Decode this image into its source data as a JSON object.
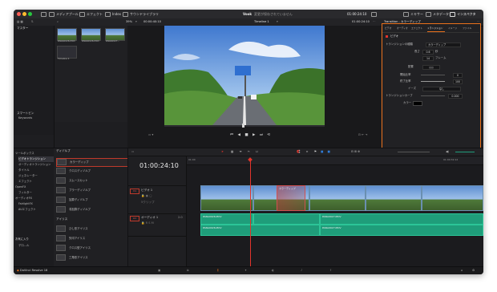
{
  "topbar": {
    "media_pool": "メディアプール",
    "effects": "エフェクト",
    "index": "Index",
    "sound_library": "サウンドライブラリ",
    "project_name": "Vook",
    "save_status": "変更が保存されていません",
    "timecode": "01:00:24:10",
    "mixer": "ミキサー",
    "metadata": "メタデータ",
    "inspector": "インスペクタ"
  },
  "bar2": {
    "zoom": "39%",
    "source_tc": "00:00:40:10",
    "timeline_name": "Timeline 1",
    "inspector_title": "Transition - カラーディップ"
  },
  "media_pool": {
    "bin": "マスター",
    "clips": [
      "PANA0026.MOV",
      "PANA0026.MOV",
      "PANA0027...",
      "Timeline 1"
    ],
    "smart_bins": "スマートビン",
    "keywords": "Keywords"
  },
  "effects_tree": [
    "ツールボックス",
    "ビデオトランジション",
    "オーディオトランジション",
    "タイトル",
    "ジェネレーター",
    "エフェクト",
    "OpenFX",
    "フィルター",
    "オーディオFX",
    "FairlightFX",
    "AUエフェクト"
  ],
  "favorites": {
    "title": "お気に入り",
    "item": "デロ...ル"
  },
  "dissolve": {
    "title": "ディゾルブ",
    "items": [
      "カラーディップ",
      "クロスディゾルブ",
      "スムースカット",
      "ブラーディゾルブ",
      "加算ディゾルブ",
      "非加算ディゾルブ"
    ]
  },
  "iris": {
    "title": "アイリス",
    "items": [
      "ひし形アイリス",
      "矢印アイリス",
      "クロス型アイリス",
      "三角形アイリス"
    ]
  },
  "inspector": {
    "tabs": [
      "ビデオ",
      "オーディオ",
      "エフェクト",
      "トランジション",
      "イメージ",
      "ファイル"
    ],
    "section": "ビデオ",
    "transition_type_label": "トランジションの種類",
    "transition_type_value": "カラーディップ",
    "duration_label": "長さ",
    "duration_seconds": "0.6",
    "seconds_unit": "秒",
    "duration_frames": "14",
    "frames_unit": "フレーム",
    "alignment_label": "配置",
    "start_ratio_label": "開始比率",
    "start_ratio_value": "0",
    "end_ratio_label": "終了比率",
    "end_ratio_value": "100",
    "ease_label": "イーズ",
    "ease_value": "なし",
    "curve_label": "トランジションカーブ",
    "curve_value": "0.000",
    "color_label": "カラー"
  },
  "timeline": {
    "timecode": "01:00:24:10",
    "ruler_start": "01:00",
    "ruler_end": "01:00:32:12",
    "video_track_id": "V1",
    "video_track_name": "ビデオ 1",
    "video_track_info": "5クリップ",
    "audio_track_id": "A1",
    "audio_track_name": "オーディオ 1",
    "audio_track_level": "2.0",
    "transition_label": "カラーディップ",
    "audio_clips": [
      "PANA0026.MOV",
      "PANA0027.MOV",
      "PANA0026.MOV",
      "PANA0027.MOV"
    ]
  },
  "footer": {
    "app_name": "DaVinci Resolve 18"
  },
  "colors": {
    "accent_orange": "#e9711c",
    "playhead_red": "#e2342b",
    "audio_green": "#1f9d7a",
    "panel_bg": "#202023"
  }
}
